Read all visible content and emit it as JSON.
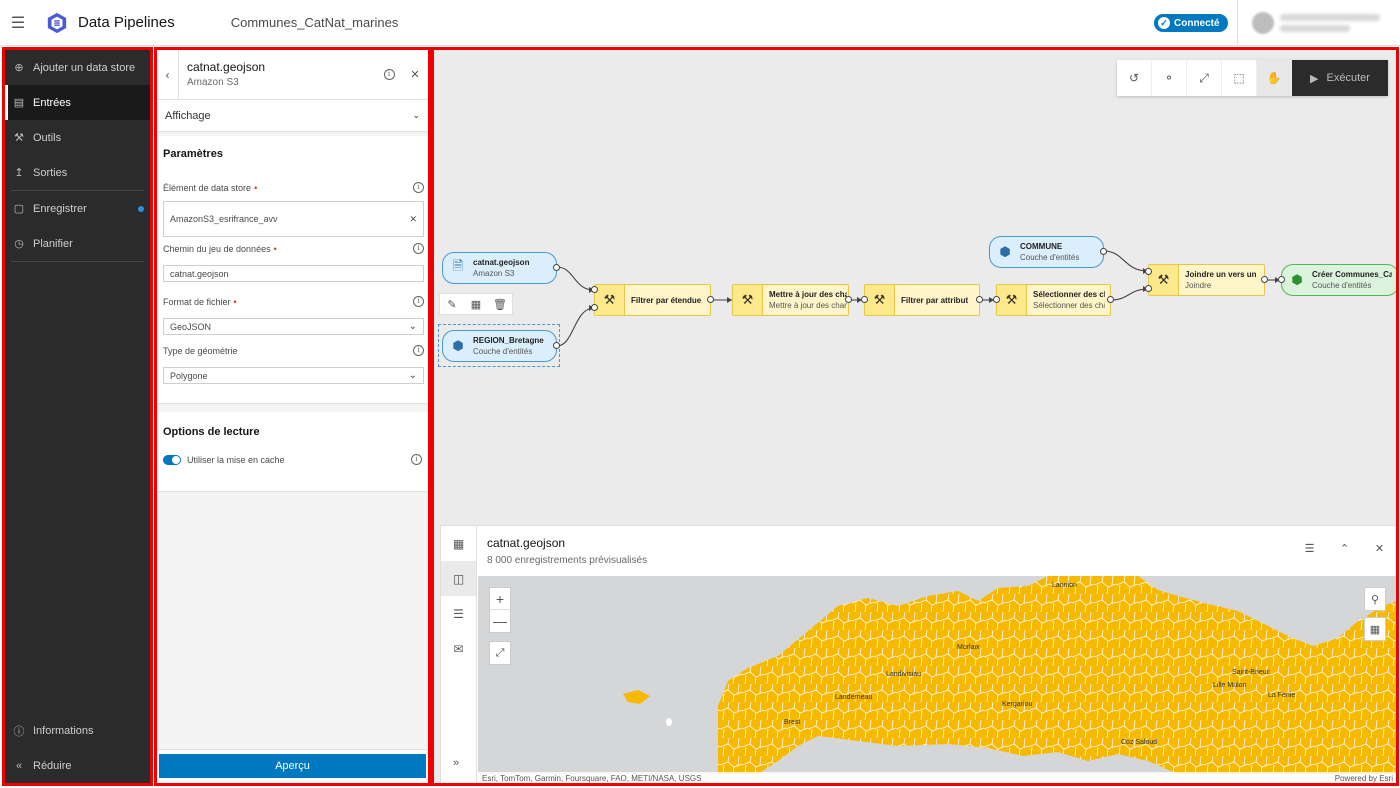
{
  "header": {
    "app_title": "Data Pipelines",
    "doc_title": "Communes_CatNat_marines",
    "status": "Connecté"
  },
  "nav": {
    "items": [
      {
        "label": "Ajouter un data store",
        "icon": "plus-circle-icon"
      },
      {
        "label": "Entrées",
        "icon": "database-icon"
      },
      {
        "label": "Outils",
        "icon": "hammer-icon"
      },
      {
        "label": "Sorties",
        "icon": "export-icon"
      },
      {
        "label": "Enregistrer",
        "icon": "save-icon"
      },
      {
        "label": "Planifier",
        "icon": "calendar-icon"
      }
    ],
    "bottom": [
      {
        "label": "Informations",
        "icon": "info-icon"
      },
      {
        "label": "Réduire",
        "icon": "collapse-icon"
      }
    ]
  },
  "props": {
    "title": "catnat.geojson",
    "subtitle": "Amazon S3",
    "affichage": "Affichage",
    "params_heading": "Paramètres",
    "fields": [
      {
        "label": "Élément de data store",
        "value": "AmazonS3_esrifrance_avv",
        "required": true
      },
      {
        "label": "Chemin du jeu de données",
        "value": "catnat.geojson",
        "required": true
      },
      {
        "label": "Format de fichier",
        "value": "GeoJSON",
        "required": true
      },
      {
        "label": "Type de géométrie",
        "value": "Polygone",
        "required": false
      }
    ],
    "options_heading": "Options de lecture",
    "cache_label": "Utiliser la mise en cache",
    "apercu": "Aperçu"
  },
  "toolbar": {
    "run_label": "Exécuter"
  },
  "nodes": {
    "catnat": {
      "name": "catnat.geojson",
      "sub": "Amazon S3"
    },
    "region": {
      "name": "REGION_Bretagne",
      "sub": "Couche d'entités"
    },
    "filtre_etendue": {
      "name": "Filtrer par étendue"
    },
    "maj": {
      "name": "Mettre à jour des chan",
      "sub": "Mettre à jour des chan"
    },
    "filtre_attr": {
      "name": "Filtrer par attribut"
    },
    "select": {
      "name": "Sélectionner des chan",
      "sub": "Sélectionner des chan"
    },
    "commune": {
      "name": "COMMUNE",
      "sub": "Couche d'entités"
    },
    "joindre": {
      "name": "Joindre un vers un",
      "sub": "Joindre"
    },
    "creer": {
      "name": "Créer Communes_Cat",
      "sub": "Couche d'entités"
    }
  },
  "preview": {
    "title": "catnat.geojson",
    "subtitle": "8 000 enregistrements prévisualisés",
    "attribution": "Esri, TomTom, Garmin, Foursquare, FAO, METI/NASA, USGS",
    "powered": "Powered by Esri",
    "cities": [
      "Lannion",
      "Morlaix",
      "Landivisiau",
      "Landerneau",
      "Brest",
      "Kergariou",
      "Saint-Brieuc",
      "Lille Mulon",
      "La Fenie",
      "Coz Saloud"
    ]
  },
  "colors": {
    "accent": "#0079c1",
    "nav_bg": "#2b2b2b",
    "highlight": "#e00000",
    "map_fill": "#f7b800"
  }
}
